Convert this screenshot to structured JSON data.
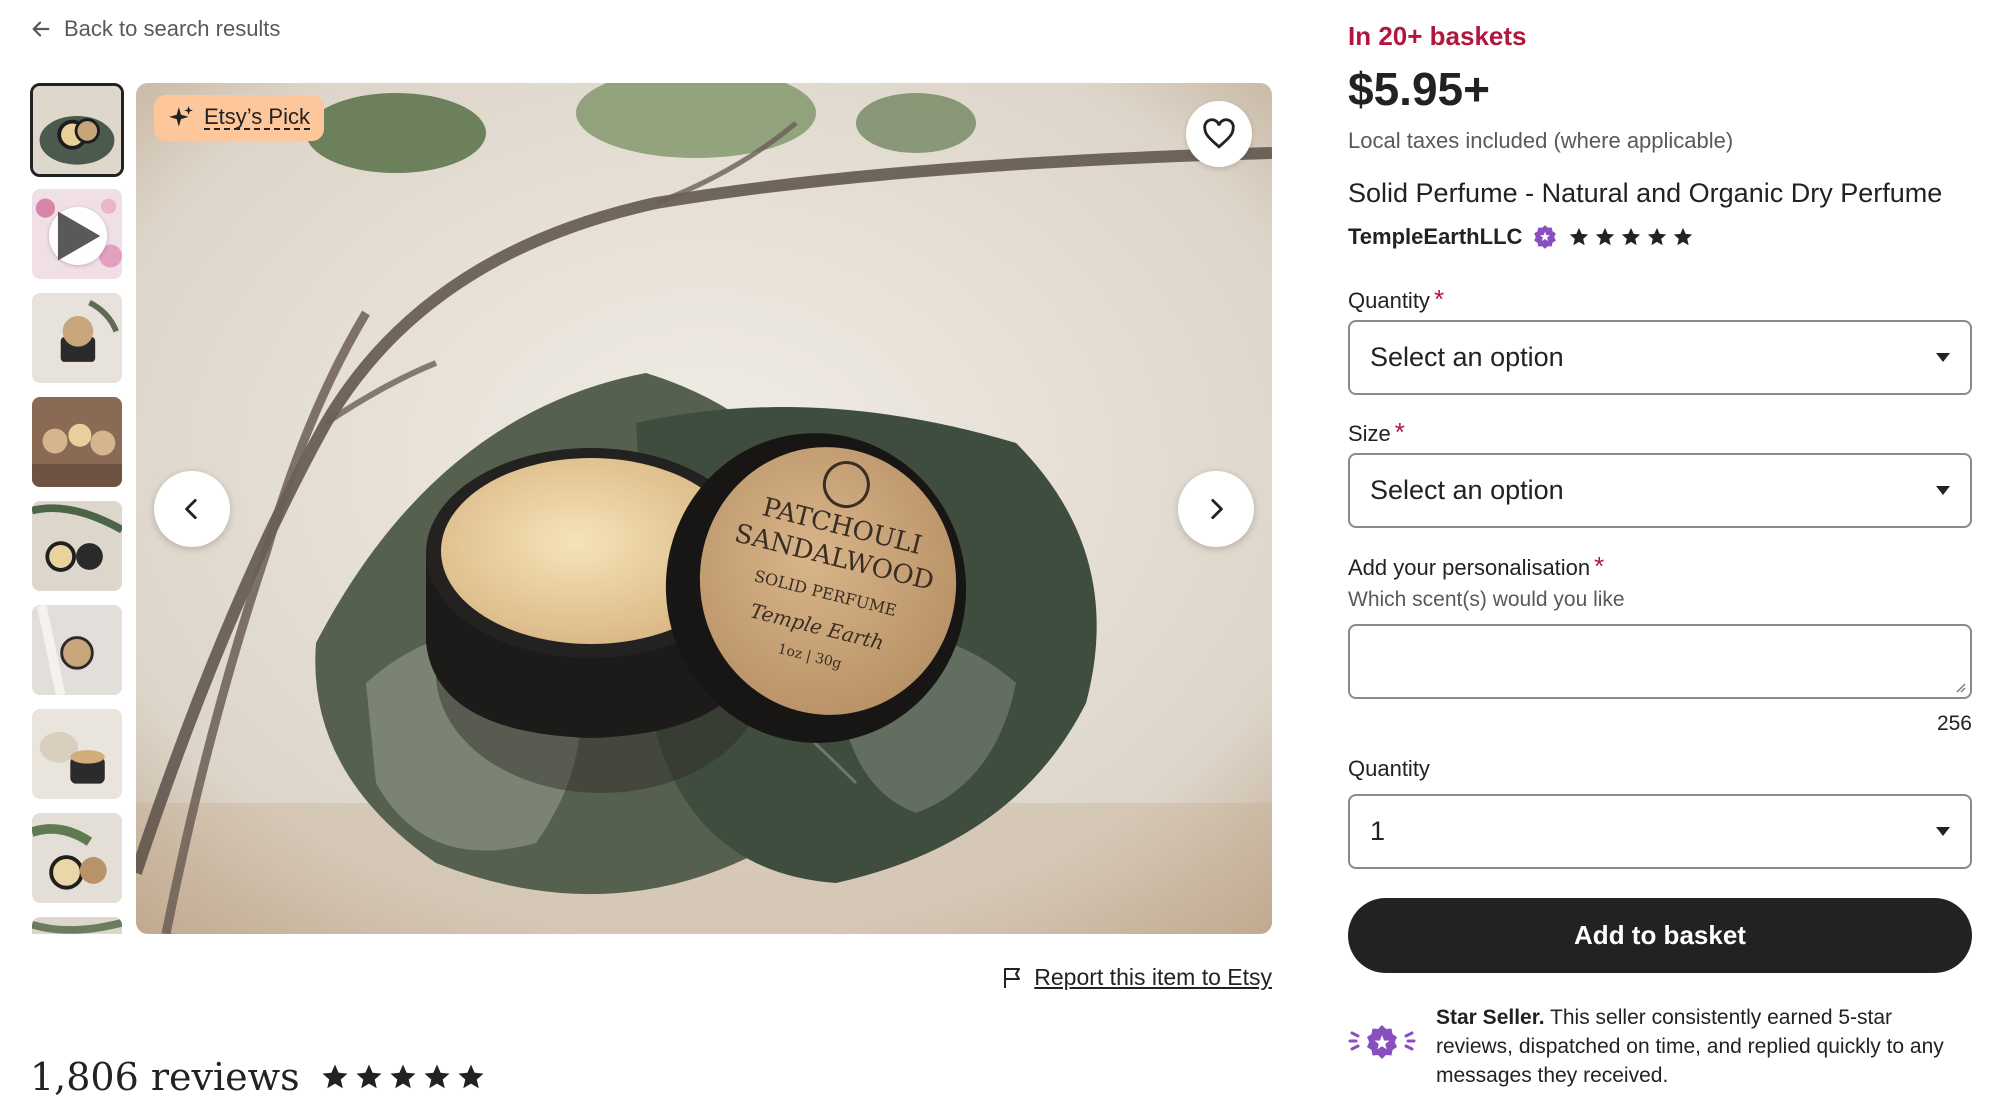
{
  "nav": {
    "back_label": "Back to search results"
  },
  "gallery": {
    "badge_label": "Etsy’s Pick",
    "report_label": "Report this item to Etsy",
    "product_label_lines": [
      "PATCHOULI",
      "SANDALWOOD",
      "SOLID PERFUME",
      "Temple Earth",
      "1oz | 30g"
    ]
  },
  "reviews": {
    "count_label": "1,806 reviews",
    "rating": 5
  },
  "product": {
    "baskets": "In 20+ baskets",
    "price": "$5.95+",
    "tax_note": "Local taxes included (where applicable)",
    "title": "Solid Perfume - Natural and Organic Dry Perfume",
    "shop_name": "TempleEarthLLC",
    "shop_rating": 5
  },
  "form": {
    "quantity_option": {
      "label": "Quantity",
      "required_mark": "*",
      "value": "Select an option"
    },
    "size": {
      "label": "Size",
      "required_mark": "*",
      "value": "Select an option"
    },
    "personalisation": {
      "label": "Add your personalisation",
      "required_mark": "*",
      "hint": "Which scent(s) would you like",
      "value": "",
      "char_counter": "256"
    },
    "quantity": {
      "label": "Quantity",
      "value": "1"
    },
    "add_button": "Add to basket"
  },
  "star_seller": {
    "title": "Star Seller.",
    "text": "This seller consistently earned 5-star reviews, dispatched on time, and replied quickly to any messages they received."
  },
  "colors": {
    "accent_red": "#b3163c",
    "badge_peach": "#fdc79b",
    "star_purple": "#8a4fbf",
    "button_dark": "#222222"
  }
}
